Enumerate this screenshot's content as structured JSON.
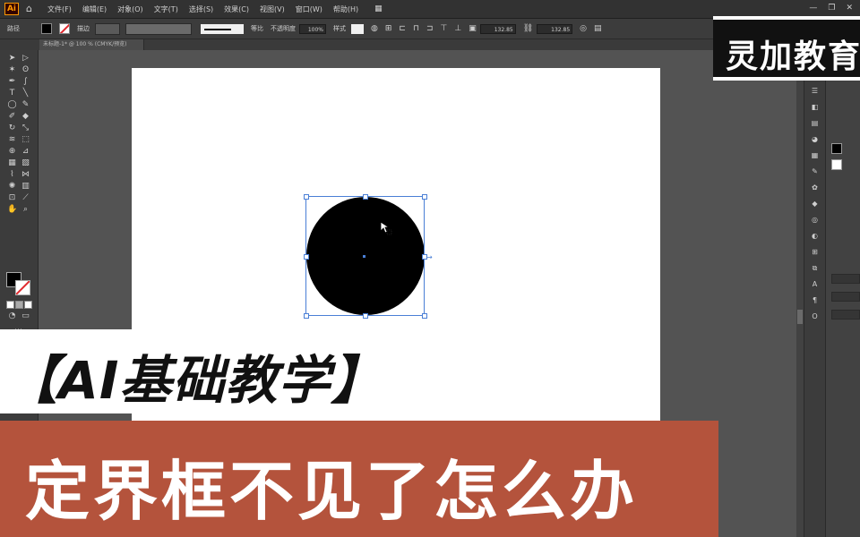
{
  "app": {
    "logo": "Ai"
  },
  "menubar": {
    "items": [
      "文件(F)",
      "编辑(E)",
      "对象(O)",
      "文字(T)",
      "选择(S)",
      "效果(C)",
      "视图(V)",
      "窗口(W)",
      "帮助(H)"
    ],
    "window_controls": [
      "—",
      "❐",
      "✕"
    ]
  },
  "controlbar": {
    "object_label": "路径",
    "stroke_label": "描边",
    "style_label": "等比",
    "opacity_label": "不透明度",
    "opacity_value": "100%",
    "style2_label": "样式",
    "width_value": "132.85",
    "height_value": "132.85"
  },
  "document": {
    "tab_title": "未标题-1* @ 100 % (CMYK/预览)"
  },
  "overlay": {
    "watermark": "灵加教育",
    "title": "【AI基础教学】",
    "subtitle": "定界框不见了怎么办"
  },
  "icons": {
    "home": "home-icon",
    "cursor": "arrow-cursor-icon",
    "colors": {
      "accent_selection": "#4a7fd6",
      "banner": "#b4533c",
      "stroke_none": "#e0282e"
    }
  }
}
